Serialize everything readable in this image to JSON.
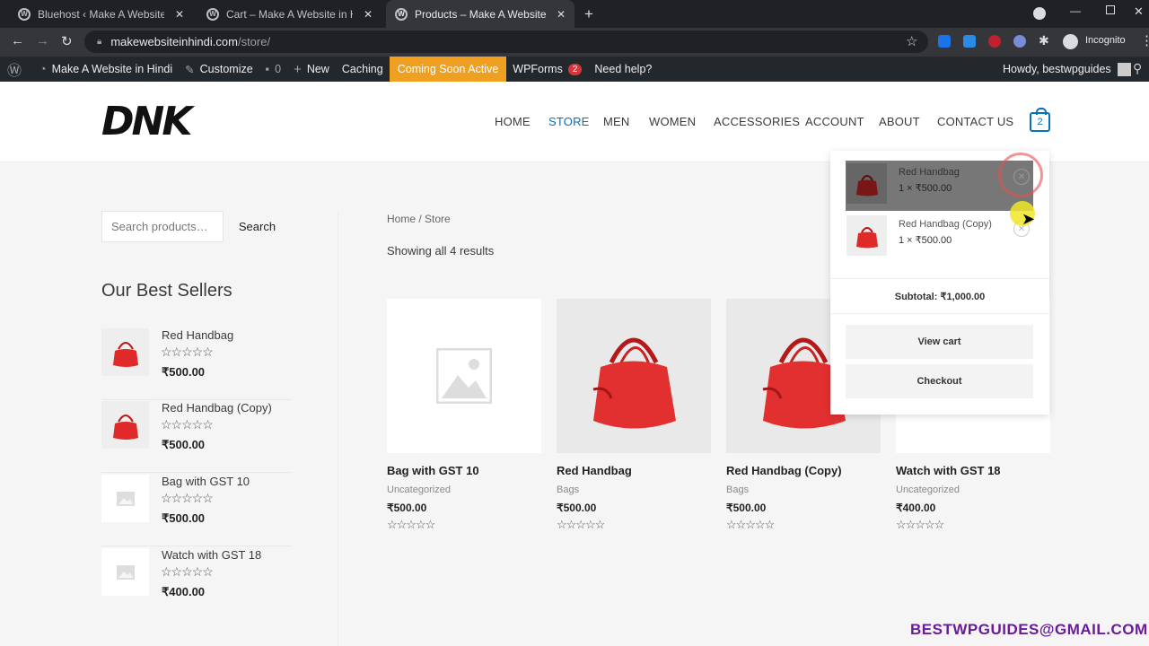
{
  "browser": {
    "tabs": [
      {
        "title": "Bluehost ‹ Make A Website in Hindi",
        "active": false
      },
      {
        "title": "Cart – Make A Website in Hindi",
        "active": false
      },
      {
        "title": "Products – Make A Website in Hindi",
        "active": true
      }
    ],
    "url_domain": "makewebsiteinhindi.com",
    "url_path": "/store/",
    "profile_label": "Incognito"
  },
  "admin_bar": {
    "site_name": "Make A Website in Hindi",
    "customize": "Customize",
    "comments_count": "0",
    "new": "New",
    "caching": "Caching",
    "coming_soon": "Coming Soon Active",
    "wpforms": "WPForms",
    "wpforms_badge": "2",
    "help": "Need help?",
    "howdy": "Howdy, bestwpguides"
  },
  "site": {
    "logo": "DNK",
    "nav": [
      "HOME",
      "STORE",
      "MEN",
      "WOMEN",
      "ACCESSORIES",
      "ACCOUNT",
      "ABOUT",
      "CONTACT US"
    ],
    "cart_count": "2"
  },
  "sidebar": {
    "search_placeholder": "Search products…",
    "search_button": "Search",
    "best_sellers_title": "Our Best Sellers",
    "items": [
      {
        "name": "Red Handbag",
        "stars": "☆☆☆☆☆",
        "price": "₹500.00"
      },
      {
        "name": "Red Handbag (Copy)",
        "stars": "☆☆☆☆☆",
        "price": "₹500.00"
      },
      {
        "name": "Bag with GST 10",
        "stars": "☆☆☆☆☆",
        "price": "₹500.00"
      },
      {
        "name": "Watch with GST 18",
        "stars": "☆☆☆☆☆",
        "price": "₹400.00"
      }
    ]
  },
  "main": {
    "breadcrumb": "Home / Store",
    "results": "Showing all 4 results",
    "products": [
      {
        "name": "Bag with GST 10",
        "category": "Uncategorized",
        "price": "₹500.00",
        "stars": "☆☆☆☆☆"
      },
      {
        "name": "Red Handbag",
        "category": "Bags",
        "price": "₹500.00",
        "stars": "☆☆☆☆☆"
      },
      {
        "name": "Red Handbag (Copy)",
        "category": "Bags",
        "price": "₹500.00",
        "stars": "☆☆☆☆☆"
      },
      {
        "name": "Watch with GST 18",
        "category": "Uncategorized",
        "price": "₹400.00",
        "stars": "☆☆☆☆☆"
      }
    ]
  },
  "mini_cart": {
    "items": [
      {
        "name": "Red Handbag",
        "qty": "1 × ₹500.00"
      },
      {
        "name": "Red Handbag (Copy)",
        "qty": "1 × ₹500.00"
      }
    ],
    "subtotal": "Subtotal: ₹1,000.00",
    "view_cart": "View cart",
    "checkout": "Checkout"
  },
  "watermark": "BESTWPGUIDES@GMAIL.COM"
}
